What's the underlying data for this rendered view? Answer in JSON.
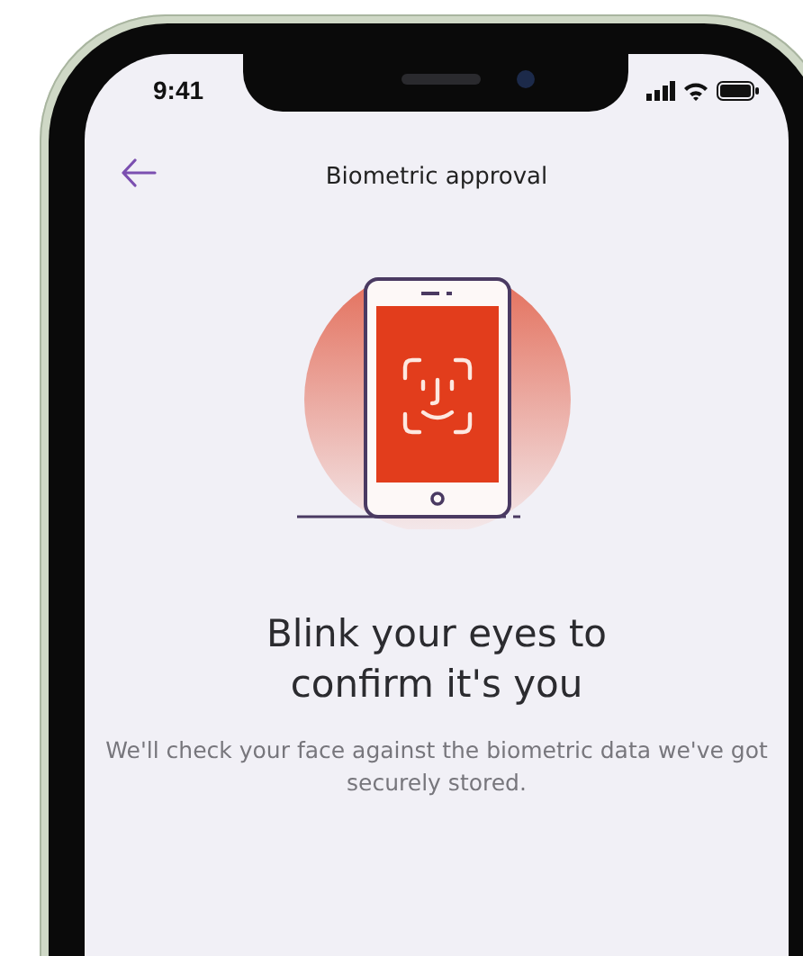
{
  "status_bar": {
    "time": "9:41"
  },
  "header": {
    "title": "Biometric approval"
  },
  "content": {
    "heading": "Blink your eyes to confirm it's you",
    "description": "We'll check your face against the biometric data we've got securely stored."
  }
}
